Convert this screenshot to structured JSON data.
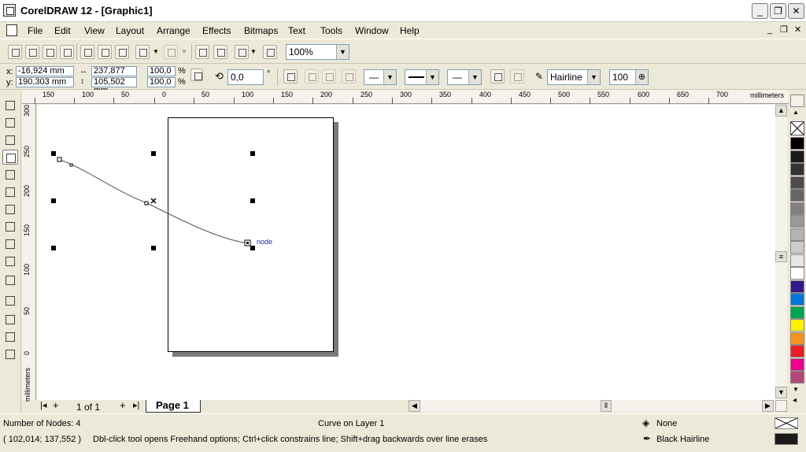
{
  "window": {
    "title": "CorelDRAW 12 - [Graphic1]",
    "minimize": "_",
    "maximize": "❐",
    "close": "✕"
  },
  "menu": [
    {
      "label": "File"
    },
    {
      "label": "Edit"
    },
    {
      "label": "View"
    },
    {
      "label": "Layout"
    },
    {
      "label": "Arrange"
    },
    {
      "label": "Effects"
    },
    {
      "label": "Bitmaps"
    },
    {
      "label": "Text"
    },
    {
      "label": "Tools"
    },
    {
      "label": "Window"
    },
    {
      "label": "Help"
    }
  ],
  "standard_toolbar": {
    "zoom_level": "100%"
  },
  "property_bar": {
    "x_label": "x:",
    "x_value": "-16,924 mm",
    "y_label": "y:",
    "y_value": "190,303 mm",
    "width_value": "237,877 mm",
    "height_value": "105,502 mm",
    "scale_x": "100,0",
    "scale_y": "100,0",
    "percent": "%",
    "rotation": "0,0",
    "degree": "°",
    "outline_width": "Hairline",
    "curve_smoothness": "100"
  },
  "ruler": {
    "units": "millimeters",
    "h_ticks": [
      "150",
      "100",
      "50",
      "0",
      "50",
      "100",
      "150",
      "200",
      "250",
      "300",
      "350",
      "400",
      "450",
      "500",
      "550",
      "600",
      "650",
      "700"
    ],
    "v_ticks": [
      "300",
      "250",
      "200",
      "150",
      "100",
      "50",
      "0"
    ]
  },
  "canvas": {
    "node_label": "node"
  },
  "page_nav": {
    "page_count": "1 of 1",
    "page_tab": "Page 1"
  },
  "status": {
    "node_count": "Number of Nodes: 4",
    "object_info": "Curve on Layer 1",
    "fill_label": "None",
    "outline_label": "Black  Hairline",
    "cursor_position": "( 102,014; 137,552 )",
    "hint": "Dbl-click tool opens Freehand options; Ctrl+click constrains line; Shift+drag backwards over line erases"
  },
  "palette_colors": [
    "#000000",
    "#1a1a1a",
    "#333333",
    "#4d4d4d",
    "#666666",
    "#808080",
    "#999999",
    "#b3b3b3",
    "#cccccc",
    "#e6e6e6",
    "#ffffff",
    "#2e1a8a",
    "#0078d7",
    "#00a651",
    "#fff200",
    "#f7941d",
    "#ed1c24",
    "#ec008c",
    "#b5467a"
  ]
}
